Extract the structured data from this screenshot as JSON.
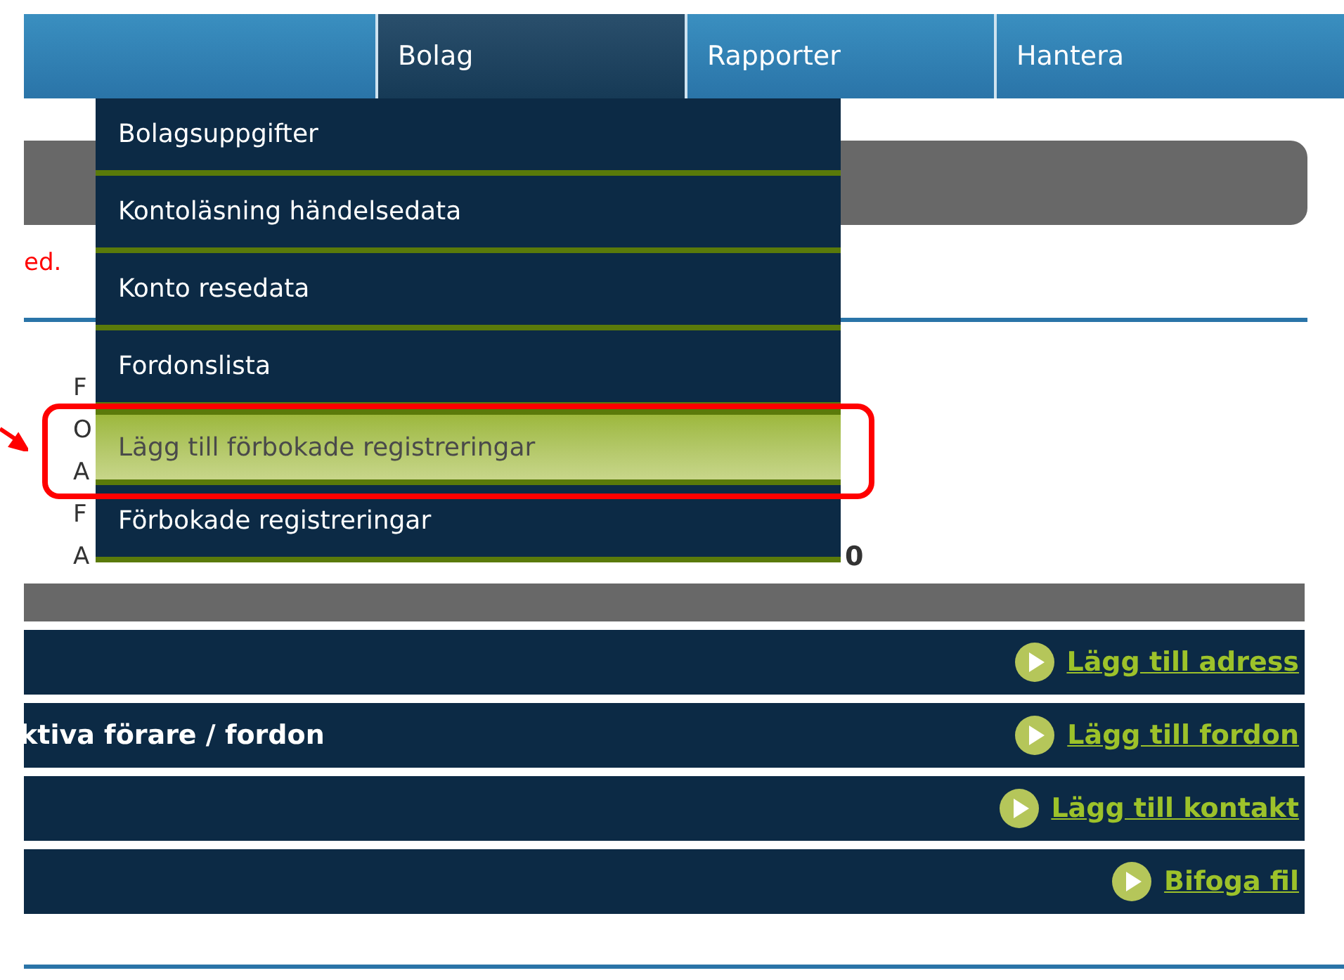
{
  "nav_tabs": [
    {
      "label": "Bolag",
      "selected": true
    },
    {
      "label": "Rapporter",
      "selected": false
    },
    {
      "label": "Hantera",
      "selected": false
    }
  ],
  "dropdown_menu": [
    {
      "label": "Bolagsuppgifter",
      "selected": false
    },
    {
      "label": "Kontoläsning händelsedata",
      "selected": false
    },
    {
      "label": "Konto resedata",
      "selected": false
    },
    {
      "label": "Fordonslista",
      "selected": false
    },
    {
      "label": "Lägg till förbokade registreringar",
      "selected": true
    },
    {
      "label": "Förbokade registreringar",
      "selected": false
    }
  ],
  "notice": "ed.",
  "info_rows": [
    {
      "label": "F"
    },
    {
      "label": "O"
    },
    {
      "label": "A"
    },
    {
      "label": "F"
    },
    {
      "label": "A",
      "value": "0"
    }
  ],
  "sections": [
    {
      "link": "Lägg till adress"
    },
    {
      "title": "ktiva förare / fordon",
      "link": "Lägg till fordon"
    },
    {
      "link": "Lägg till kontakt"
    },
    {
      "link": "Bifoga fil"
    }
  ]
}
